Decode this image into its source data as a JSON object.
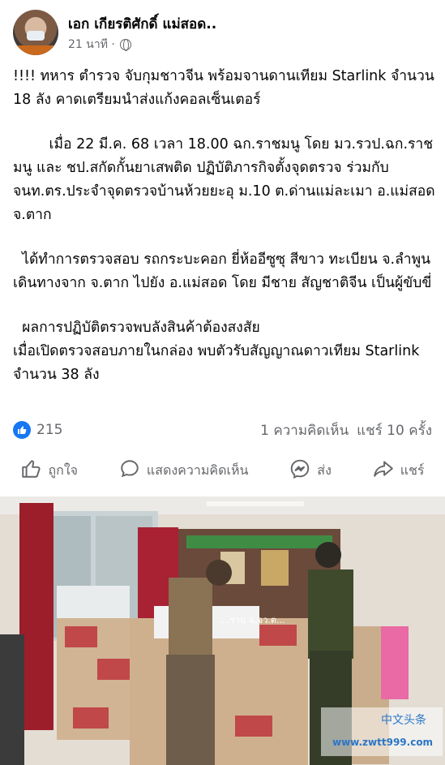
{
  "post": {
    "author": "เอก เกียรติศักดิ์ แม่สอด..",
    "time": "21 นาที ·",
    "paragraphs": [
      "!!!! ทหาร ตำรวจ จับกุมชาวจีน พร้อมจานดานเทียม Starlink จำนวน 18 ลัง คาดเตรียมนำส่งแก้งคอลเซ็นเตอร์",
      "        เมื่อ 22 มี.ค. 68 เวลา 18.00 ฉก.ราชมนู โดย มว.รวป.ฉก.ราชมนู และ ชป.สกัดกั้นยาเสพติด ปฏิบัติภารกิจตั้งจุดตรวจ ร่วมกับ จนท.ตร.ประจำจุดตรวจบ้านห้วยยะอุ ม.10 ต.ด่านแม่ละเมา อ.แม่สอด จ.ตาก",
      "  ได้ทำการตรวจสอบ รถกระบะคอก ยี่ห้ออีซูซุ สีขาว ทะเบียน จ.ลำพูน เดินทางจาก จ.ตาก ไปยัง อ.แม่สอด โดย มีชาย สัญชาติจีน เป็นผู้ขับขี่",
      "  ผลการปฏิบัติตรวจพบลังสินค้าต้องสงสัย\nเมื่อเปิดตรวจสอบภายในกล่อง พบตัวรับสัญญาณดาวเทียม Starlink จำนวน 38 ลัง"
    ]
  },
  "stats": {
    "likes": "215",
    "comments": "1 ความคิดเห็น",
    "shares": "แชร์ 10 ครั้ง"
  },
  "actions": {
    "like": "ถูกใจ",
    "comment": "แสดงความคิดเห็น",
    "send": "ส่ง",
    "share": "แชร์"
  },
  "photo": {
    "sign_text": "....ราม ฉ.จว.ต...",
    "watermark": "www.zwtt999.com",
    "watermark_brand": "中文头条"
  },
  "colors": {
    "accent": "#1877f2",
    "secondary_text": "#65676b"
  }
}
